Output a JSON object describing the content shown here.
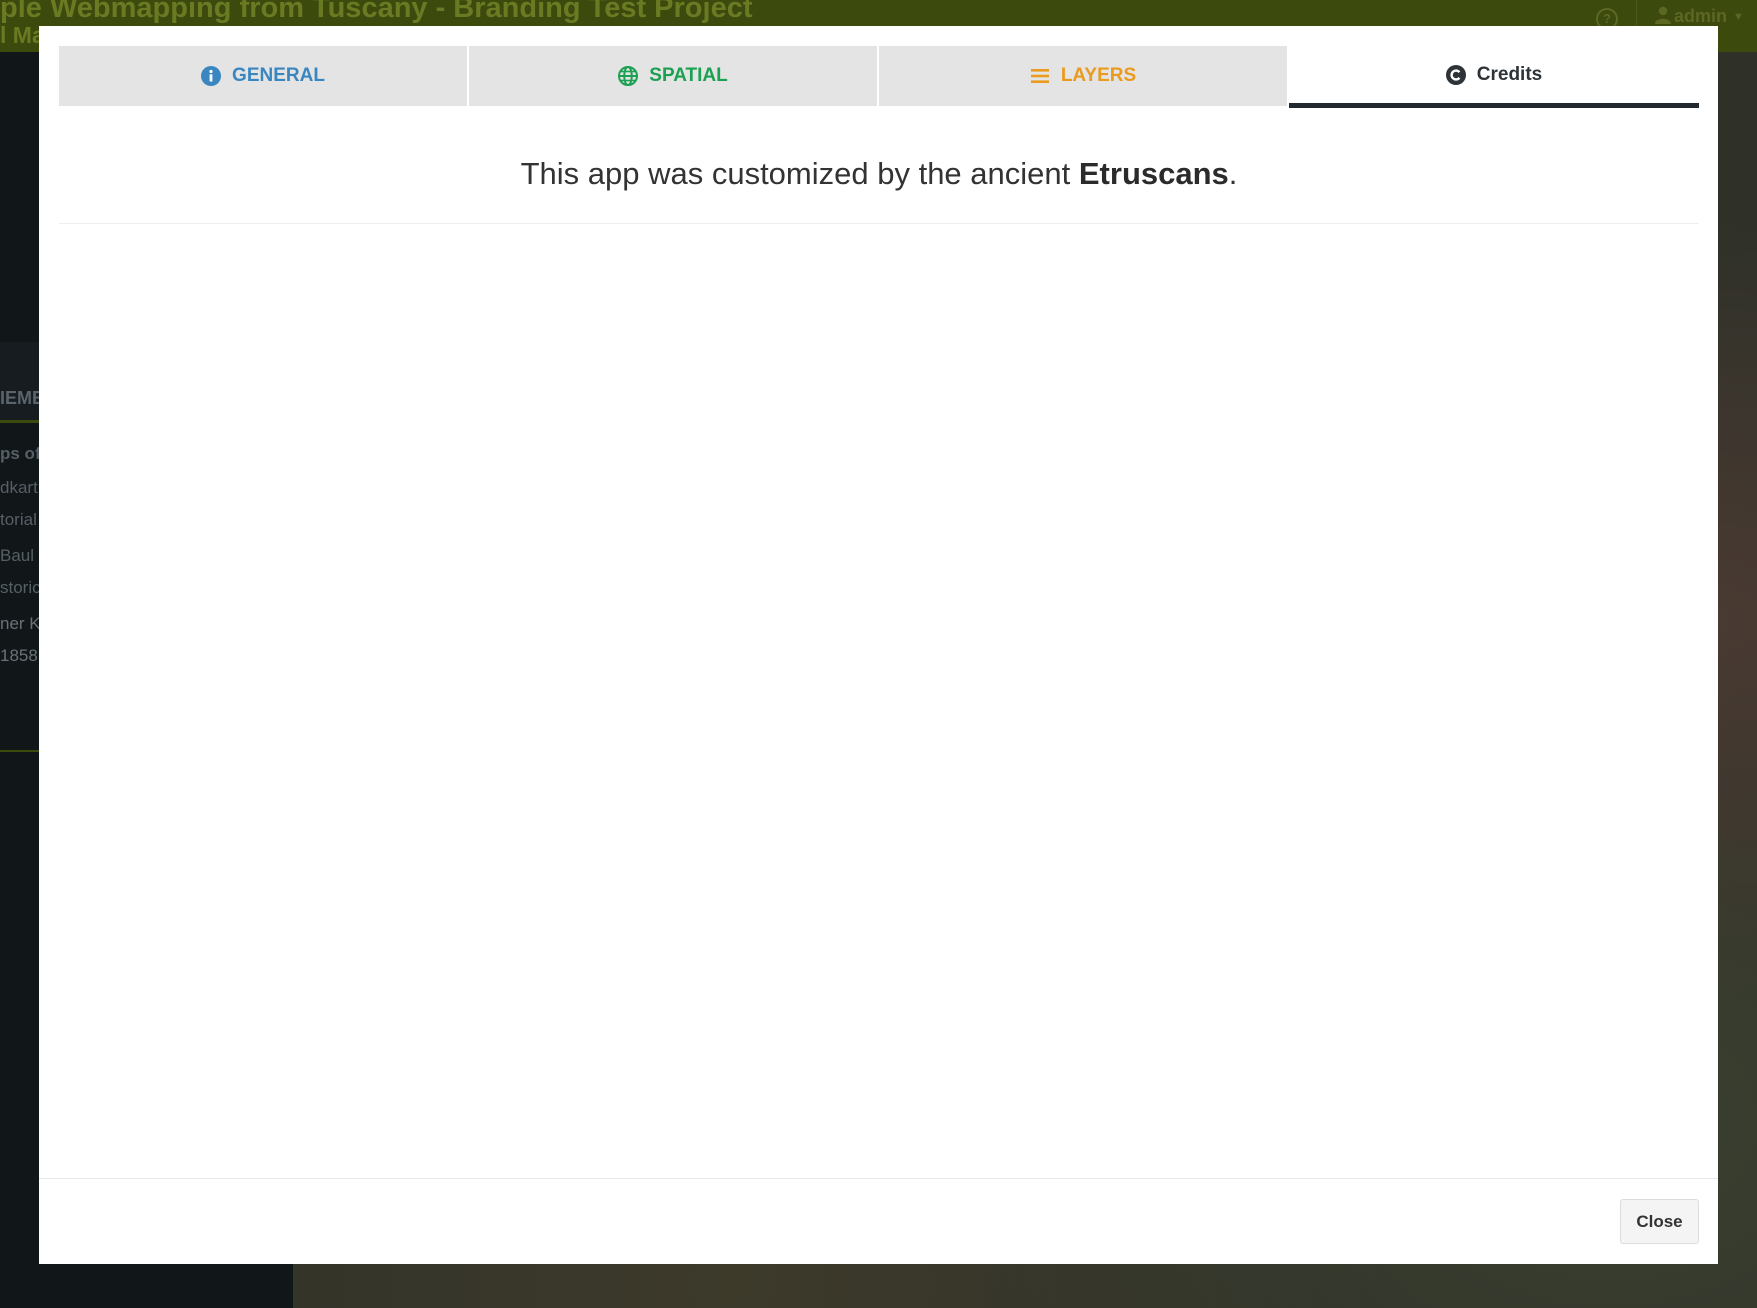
{
  "app": {
    "title": "ple Webmapping from Tuscany - Branding Test Project",
    "subtitle": "l Ma",
    "user": "admin"
  },
  "sidebar": {
    "heading": "IEME",
    "items": [
      {
        "label": "ps of S",
        "bold": true
      },
      {
        "label": "dkart",
        "bold": false
      },
      {
        "label": "torial",
        "bold": false
      },
      {
        "label": "Baul",
        "bold": false
      },
      {
        "label": "storic",
        "bold": false
      },
      {
        "label": "ner Ka",
        "bold": false
      },
      {
        "label": "1858",
        "bold": false
      }
    ]
  },
  "modal": {
    "tabs": [
      {
        "label": "GENERAL",
        "icon": "info-icon",
        "color": "#3a86c0",
        "active": false
      },
      {
        "label": "SPATIAL",
        "icon": "globe-icon",
        "color": "#1ca052",
        "active": false
      },
      {
        "label": "LAYERS",
        "icon": "bars-icon",
        "color": "#ea9a1c",
        "active": false
      },
      {
        "label": "Credits",
        "icon": "copyright-icon",
        "color": "#2e3337",
        "active": true
      }
    ],
    "credits": {
      "text_before": "This app was customized by the ancient ",
      "text_bold": "Etruscans",
      "text_after": "."
    },
    "close_label": "Close"
  },
  "colors": {
    "header_bg": "#3d4a0e",
    "accent": "#222a2f"
  }
}
